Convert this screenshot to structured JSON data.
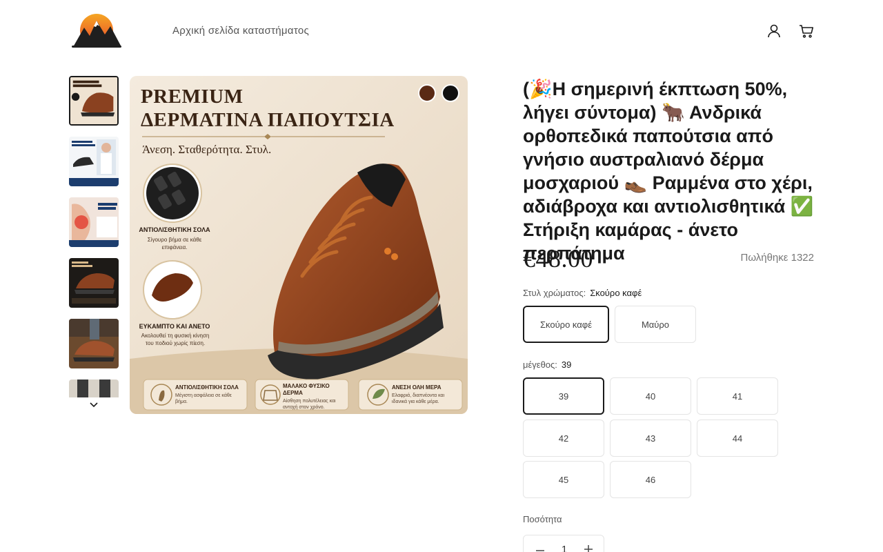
{
  "header": {
    "home_link": "Αρχική σελίδα καταστήματος",
    "icons": [
      "account-icon",
      "cart-icon"
    ]
  },
  "gallery": {
    "thumbnail_count": 6,
    "main_image": {
      "title_line1": "PREMIUM",
      "title_line2": "ΔΕΡΜΑΤΙΝΑ ΠΑΠΟΥΤΣΙΑ",
      "tagline": "Άνεση. Σταθερότητα. Στυλ.",
      "feature1_title": "ΑΝΤΙΟΛΙΣΘΗΤΙΚΗ ΣΟΛΑ",
      "feature1_text": "Σίγουρο βήμα σε κάθε επιφάνεια.",
      "feature2_title": "ΕΥΚΑΜΠΤΟ ΚΑΙ ΑΝΕΤΟ",
      "feature2_text": "Ακολουθεί τη φυσική κίνηση του ποδιού χωρίς πίεση.",
      "badge1_title": "ΑΝΤΙΟΛΙΣΘΗΤΙΚΗ ΣΟΛΑ",
      "badge1_text": "Μέγιστη ασφάλεια σε κάθε βήμα.",
      "badge2_title": "ΜΑΛΑΚΟ ΦΥΣΙΚΟ ΔΕΡΜΑ",
      "badge2_text": "Αίσθηση πολυτέλειας και αντοχή στον χρόνο.",
      "badge3_title": "ΑΝΕΣΗ ΟΛΗ ΜΕΡΑ",
      "badge3_text": "Ελαφριά, διαπνέοντα και ιδανικά για κάθε μέρα.",
      "swatch_colors": [
        "#5a2a14",
        "#111111"
      ]
    }
  },
  "product": {
    "title": "(🎉Η σημερινή έκπτωση 50%, λήγει σύντομα) 🐂 Ανδρικά ορθοπεδικά παπούτσια από γνήσιο αυστραλιανό δέρμα μοσχαριού 👞 Ραμμένα στο χέρι, αδιάβροχα και αντιολισθητικά ✅ Στήριξη καμάρας - άνετο περπάτημα",
    "price": "€48.00",
    "sold": "Πωλήθηκε 1322",
    "color_label": "Στυλ χρώματος:",
    "color_selected": "Σκούρο καφέ",
    "colors": [
      "Σκούρο καφέ",
      "Μαύρο"
    ],
    "size_label": "μέγεθος:",
    "size_selected": "39",
    "sizes": [
      "39",
      "40",
      "41",
      "42",
      "43",
      "44",
      "45",
      "46"
    ],
    "quantity_label": "Ποσότητα",
    "quantity": "1"
  },
  "colors": {
    "text": "#1a1a1a",
    "muted": "#777777",
    "border": "#e4e4e4"
  }
}
